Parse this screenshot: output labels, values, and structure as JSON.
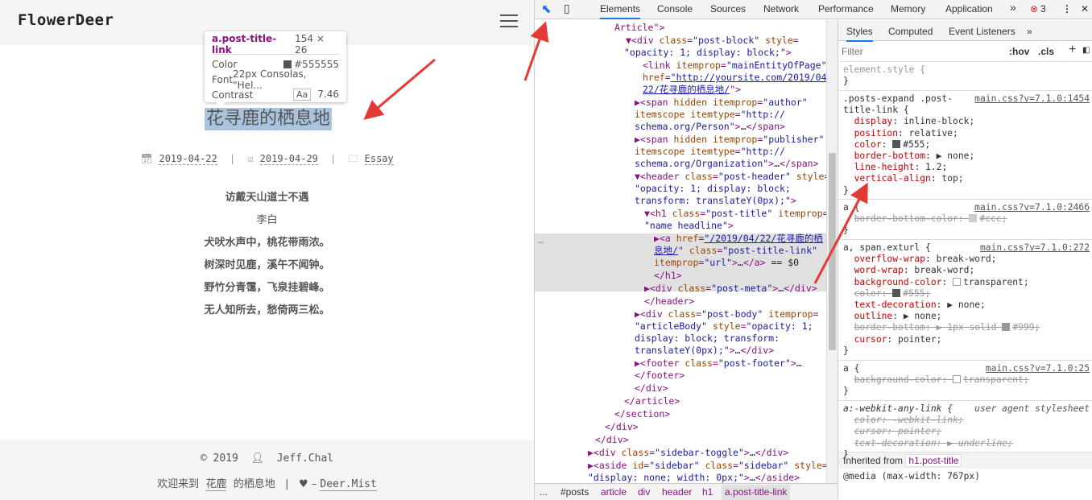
{
  "blog": {
    "logo": "FlowerDeer",
    "title": "花寻鹿的栖息地",
    "tooltip": {
      "name": "a.post-title-link",
      "size": "154 × 26",
      "color_label": "Color",
      "color_value": "#555555",
      "font_label": "Font",
      "font_value": "22px Consolas, \"Hel...",
      "contrast_label": "Contrast",
      "aa": "Aa",
      "contrast_value": "7.46"
    },
    "meta": {
      "created": "2019-04-22",
      "updated": "2019-04-29",
      "category": "Essay",
      "sep": "|"
    },
    "poem": {
      "title": "访戴天山道士不遇",
      "author": "李白",
      "lines": [
        "犬吠水声中，桃花带雨浓。",
        "树深时见鹿，溪午不闻钟。",
        "野竹分青霭，飞泉挂碧峰。",
        "无人知所去，愁倚两三松。"
      ]
    },
    "footer": {
      "copyright": "© 2019",
      "author": "Jeff.Chal",
      "welcome": "欢迎来到",
      "site": "花鹿",
      "welcome_tail": "的栖息地",
      "sep": "|",
      "dash": "–",
      "link": "Deer.Mist"
    }
  },
  "devtools": {
    "tabs": [
      "Elements",
      "Console",
      "Sources",
      "Network",
      "Performance",
      "Memory",
      "Application"
    ],
    "more": "»",
    "error_count": "3",
    "styles_tabs": [
      "Styles",
      "Computed",
      "Event Listeners",
      "»"
    ],
    "filter_placeholder": "Filter",
    "hov": ":hov",
    "cls": ".cls",
    "plus": "+",
    "breadcrumb": [
      "...",
      "#posts",
      "article",
      "div",
      "header",
      "h1",
      "a.post-title-link"
    ],
    "inherited_label": "Inherited from",
    "inherited_value": "h1.post-title",
    "media": "@media (max-width: 767px)"
  },
  "colors": {
    "accent": "#1a73e8",
    "selection": "#aac4e0",
    "arrow": "#e53935"
  }
}
